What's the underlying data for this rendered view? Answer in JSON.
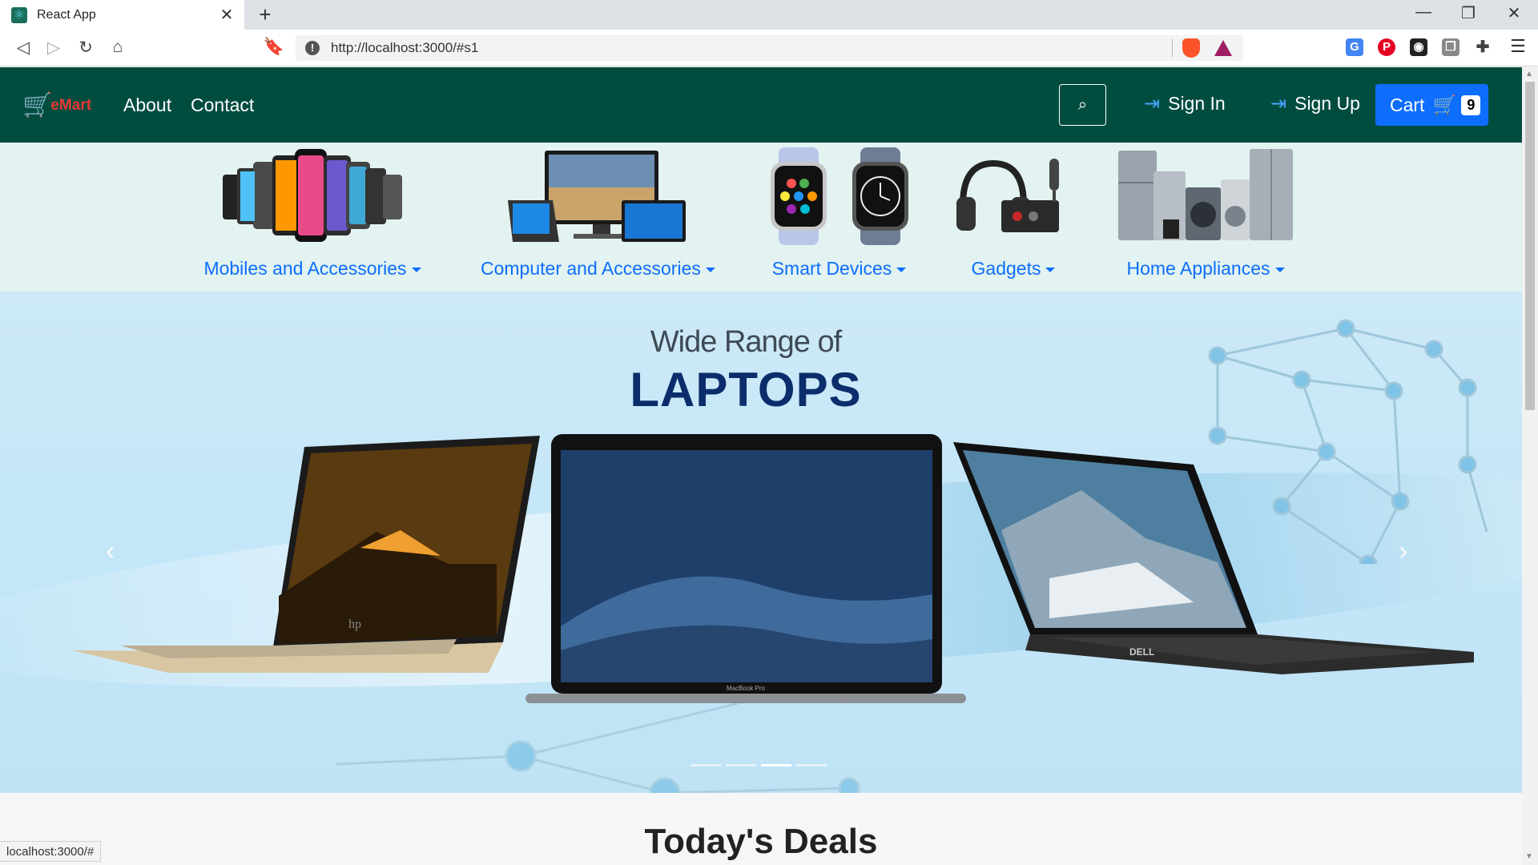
{
  "browser": {
    "tab_title": "React App",
    "url": "http://localhost:3000/#s1",
    "status_url": "localhost:3000/#"
  },
  "navbar": {
    "brand": "eMart",
    "links": [
      "About",
      "Contact"
    ],
    "sign_in": "Sign In",
    "sign_up": "Sign Up",
    "cart_label": "Cart",
    "cart_count": "9",
    "colors": {
      "background": "#004d40",
      "cart_button": "#0d6efd"
    }
  },
  "categories": [
    {
      "label": "Mobiles and Accessories",
      "icon": "mobile-phones-image"
    },
    {
      "label": "Computer and Accessories",
      "icon": "computers-image"
    },
    {
      "label": "Smart Devices",
      "icon": "smart-watches-image"
    },
    {
      "label": "Gadgets",
      "icon": "headphones-gadgets-image"
    },
    {
      "label": "Home Appliances",
      "icon": "home-appliances-image"
    }
  ],
  "hero": {
    "line1": "Wide Range of",
    "line2": "LAPTOPS",
    "laptop_logos": [
      "hp",
      "MacBook Pro",
      "DELL"
    ],
    "slide_count": 4,
    "active_slide": 3
  },
  "deals": {
    "title": "Today's Deals"
  }
}
